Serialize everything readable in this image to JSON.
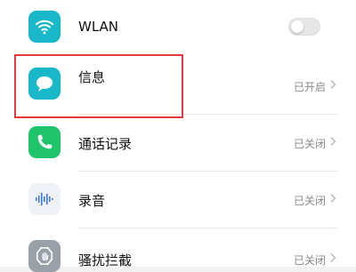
{
  "settings": {
    "wlan": {
      "label": "WLAN",
      "toggle_on": false,
      "icon": "wifi-icon"
    },
    "items": [
      {
        "label": "信息",
        "status": "已开启",
        "icon": "message-icon"
      },
      {
        "label": "通话记录",
        "status": "已关闭",
        "icon": "phone-icon"
      },
      {
        "label": "录音",
        "status": "已关闭",
        "icon": "sound-wave-icon"
      },
      {
        "label": "骚扰拦截",
        "status": "已关闭",
        "icon": "shield-icon"
      }
    ]
  },
  "colors": {
    "accent_teal": "#19b8c9",
    "green": "#1fc46a",
    "highlight_red": "#e3393b"
  }
}
